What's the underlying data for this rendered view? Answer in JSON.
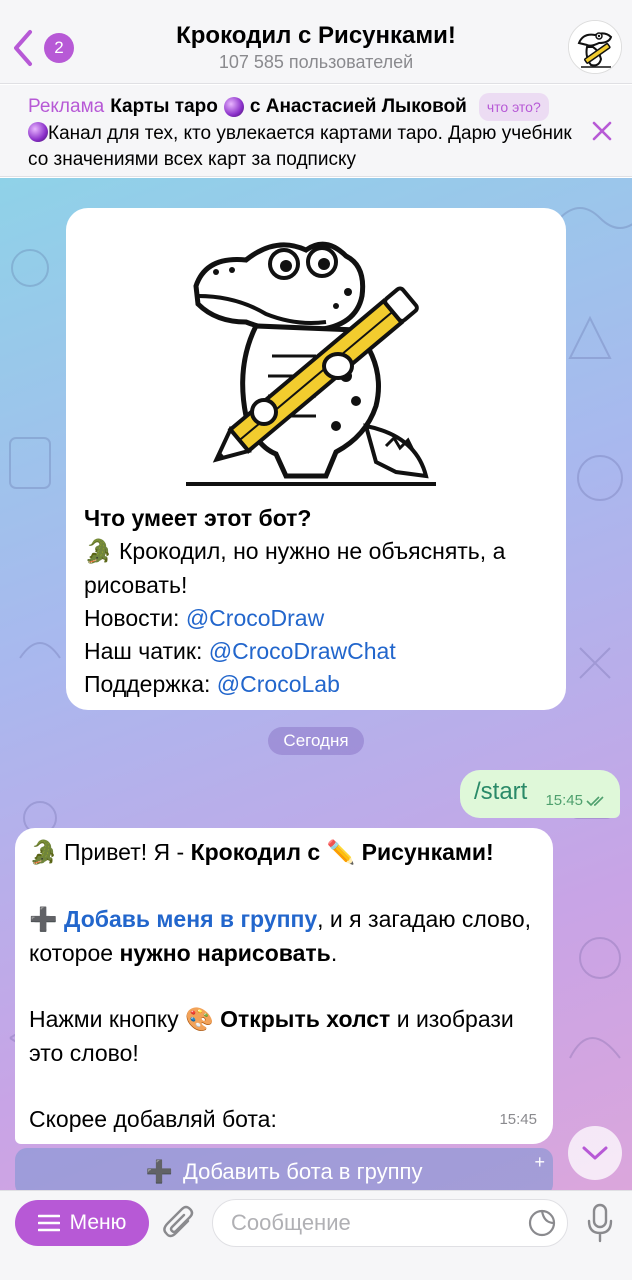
{
  "header": {
    "back_count": "2",
    "title": "Крокодил с Рисунками!",
    "subtitle": "107 585 пользователей"
  },
  "ad": {
    "label": "Реклама",
    "title_part1": "Карты таро",
    "title_part2": "с Анастасией Лыковой",
    "what_label": "что это?",
    "text": "Канал для тех, кто увлекается картами таро. Дарю учебник со значениями всех карт за подписку"
  },
  "bot_card": {
    "heading": "Что умеет этот бот?",
    "line1": "Крокодил, но нужно не объяснять, а рисовать!",
    "news_label": "Новости:",
    "news_link": "@CrocoDraw",
    "chat_label": "Наш чатик:",
    "chat_link": "@CrocoDrawChat",
    "support_label": "Поддержка:",
    "support_link": "@CrocoLab"
  },
  "date_separator": "Сегодня",
  "outgoing": {
    "text": "/start",
    "time": "15:45"
  },
  "incoming": {
    "greet_pre": "Привет! Я -",
    "greet_b1": "Крокодил с",
    "greet_b2": "Рисунками!",
    "p2_link": "Добавь меня в группу",
    "p2_mid": ", и я загадаю слово, которое",
    "p2_bold": "нужно нарисовать",
    "p2_end": ".",
    "p3_pre": "Нажми кнопку",
    "p3_bold": "Открыть холст",
    "p3_end": "и изобрази это слово!",
    "p4": "Скорее добавляй бота:",
    "time": "15:45"
  },
  "inline_button": {
    "label": "Добавить бота в группу"
  },
  "bottom": {
    "menu_label": "Меню",
    "input_placeholder": "Сообщение"
  },
  "colors": {
    "accent": "#b759d6",
    "link": "#2266cc",
    "outgoing_bubble": "#dff8d9"
  }
}
